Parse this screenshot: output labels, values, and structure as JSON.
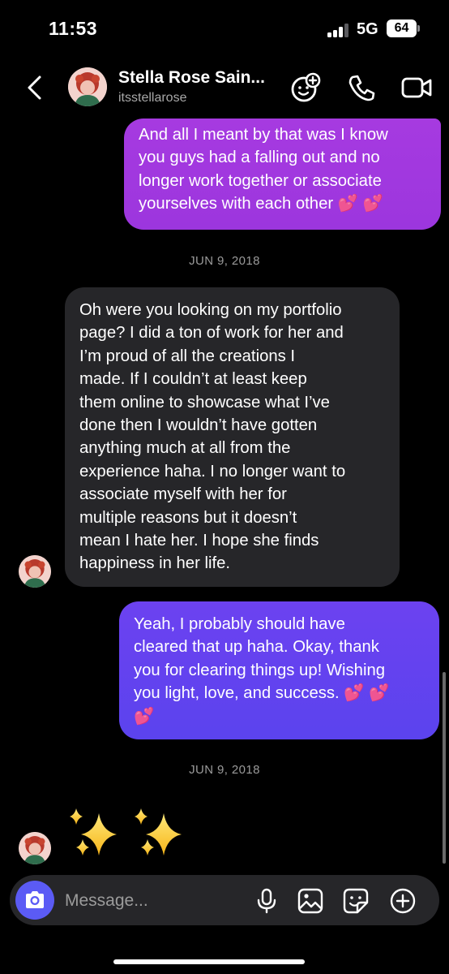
{
  "status_bar": {
    "time": "11:53",
    "network": "5G",
    "battery": "64"
  },
  "header": {
    "contact_name": "Stella Rose Sain...",
    "contact_handle": "itsstellarose",
    "icons": [
      "back-chevron-icon",
      "sticker-add-icon",
      "phone-icon",
      "video-camera-icon"
    ]
  },
  "messages": [
    {
      "direction": "sent",
      "text": "And all I meant by that was I know\nyou guys had a falling out and no\nlonger work together or associate\nyourselves with each other 💕 💕"
    },
    {
      "type": "date",
      "text": "JUN 9, 2018"
    },
    {
      "direction": "received",
      "text": "Oh were you looking on my portfolio\npage? I did a ton of work for her and\nI’m proud of all the creations I\nmade. If I couldn’t at least keep\nthem online to showcase what I’ve\ndone then I wouldn’t have gotten\nanything  much at all from the\nexperience haha. I no longer want to\nassociate myself with her for\nmultiple reasons but it doesn’t\nmean I hate her. I hope she finds\nhappiness in her life."
    },
    {
      "direction": "sent",
      "text": "Yeah, I probably should have\ncleared that up haha. Okay, thank\nyou for clearing things up! Wishing\nyou light, love, and success. 💕 💕\n💕"
    },
    {
      "type": "date",
      "text": "JUN 9, 2018"
    },
    {
      "direction": "received",
      "emoji": "sparkles-icon"
    }
  ],
  "composer": {
    "placeholder": "Message...",
    "icons": [
      "camera-icon",
      "microphone-icon",
      "image-icon",
      "sticker-icon",
      "plus-circle-icon"
    ]
  },
  "colors": {
    "background": "#000000",
    "sent_bubble_1": "#a43ae0",
    "sent_bubble_2": "#6343ef",
    "received_bubble": "#262629",
    "camera_button": "#5b5bf5"
  }
}
